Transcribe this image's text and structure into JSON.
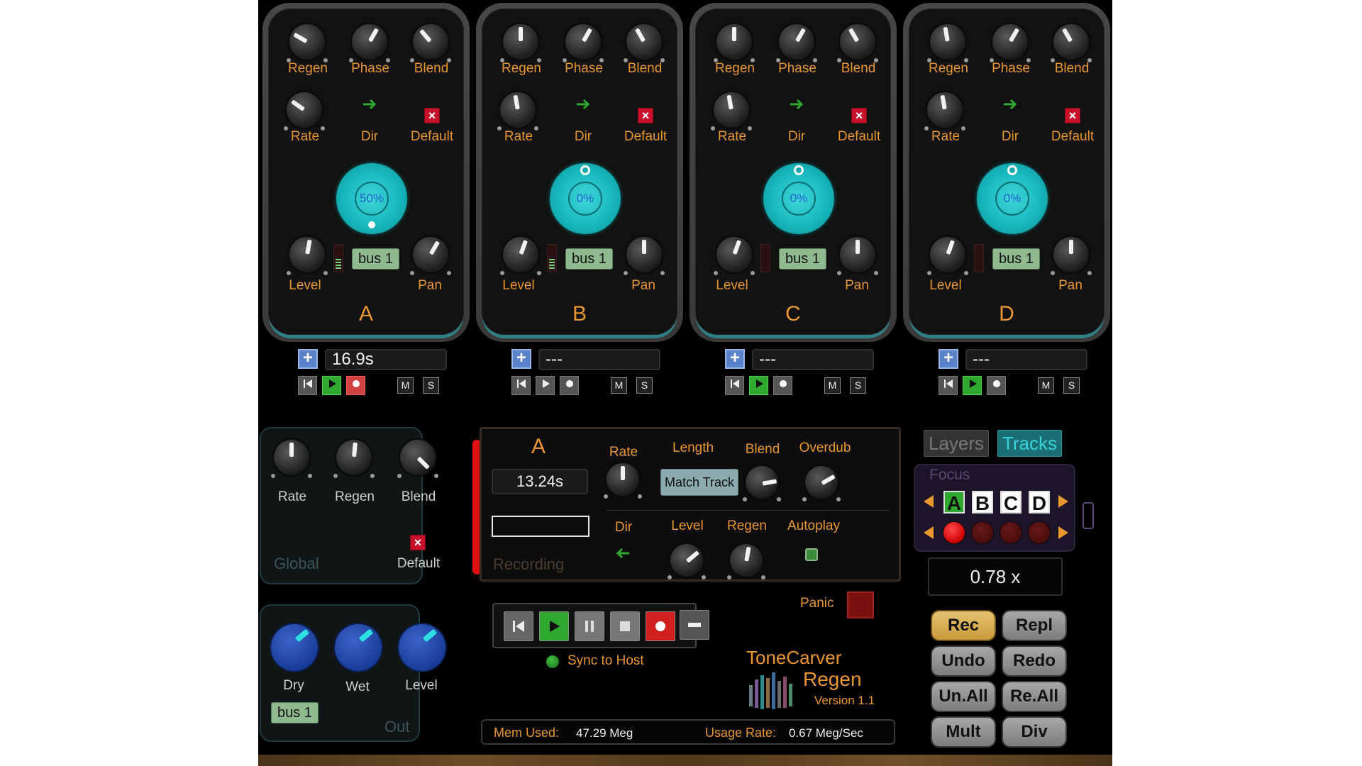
{
  "tracks": [
    {
      "letter": "A",
      "labels": {
        "regen": "Regen",
        "phase": "Phase",
        "blend": "Blend",
        "rate": "Rate",
        "dir": "Dir",
        "default": "Default",
        "level": "Level",
        "pan": "Pan"
      },
      "bus": "bus 1",
      "dial_value": "50%",
      "time": "16.9s",
      "play_active": true,
      "rec_active": true
    },
    {
      "letter": "B",
      "labels": {
        "regen": "Regen",
        "phase": "Phase",
        "blend": "Blend",
        "rate": "Rate",
        "dir": "Dir",
        "default": "Default",
        "level": "Level",
        "pan": "Pan"
      },
      "bus": "bus 1",
      "dial_value": "0%",
      "time": "---",
      "play_active": false,
      "rec_active": false
    },
    {
      "letter": "C",
      "labels": {
        "regen": "Regen",
        "phase": "Phase",
        "blend": "Blend",
        "rate": "Rate",
        "dir": "Dir",
        "default": "Default",
        "level": "Level",
        "pan": "Pan"
      },
      "bus": "bus 1",
      "dial_value": "0%",
      "time": "---",
      "play_active": true,
      "rec_active": false
    },
    {
      "letter": "D",
      "labels": {
        "regen": "Regen",
        "phase": "Phase",
        "blend": "Blend",
        "rate": "Rate",
        "dir": "Dir",
        "default": "Default",
        "level": "Level",
        "pan": "Pan"
      },
      "bus": "bus 1",
      "dial_value": "0%",
      "time": "---",
      "play_active": true,
      "rec_active": false
    }
  ],
  "transport_small": {
    "plus": "+",
    "mute": "M",
    "solo": "S"
  },
  "global": {
    "rate": "Rate",
    "regen": "Regen",
    "blend": "Blend",
    "title": "Global",
    "default": "Default"
  },
  "out": {
    "dry": "Dry",
    "wet": "Wet",
    "level": "Level",
    "bus": "bus 1",
    "title": "Out"
  },
  "recorder": {
    "track": "A",
    "time": "13.24s",
    "status": "Recording",
    "rate": "Rate",
    "length": "Length",
    "blend": "Blend",
    "overdub": "Overdub",
    "match_track": "Match Track",
    "dir": "Dir",
    "level": "Level",
    "regen": "Regen",
    "autoplay": "Autoplay"
  },
  "main_transport": {
    "sync": "Sync to Host",
    "panic": "Panic"
  },
  "brand": {
    "name": "ToneCarver",
    "product": "Regen",
    "version": "Version 1.1"
  },
  "status_bar": {
    "mem_label": "Mem Used:",
    "mem_value": "47.29 Meg",
    "usage_label": "Usage Rate:",
    "usage_value": "0.67 Meg/Sec"
  },
  "right": {
    "tabs": [
      "Layers",
      "Tracks"
    ],
    "active_tab": "Tracks",
    "focus_label": "Focus",
    "focus_letters": [
      "A",
      "B",
      "C",
      "D"
    ],
    "speed": "0.78 x",
    "buttons": [
      "Rec",
      "Repl",
      "Undo",
      "Redo",
      "Un.All",
      "Re.All",
      "Mult",
      "Div"
    ]
  },
  "colors": {
    "accent_orange": "#e8962f",
    "teal": "#17b8bd",
    "play_green": "#2ea82e",
    "rec_red": "#d04040"
  }
}
